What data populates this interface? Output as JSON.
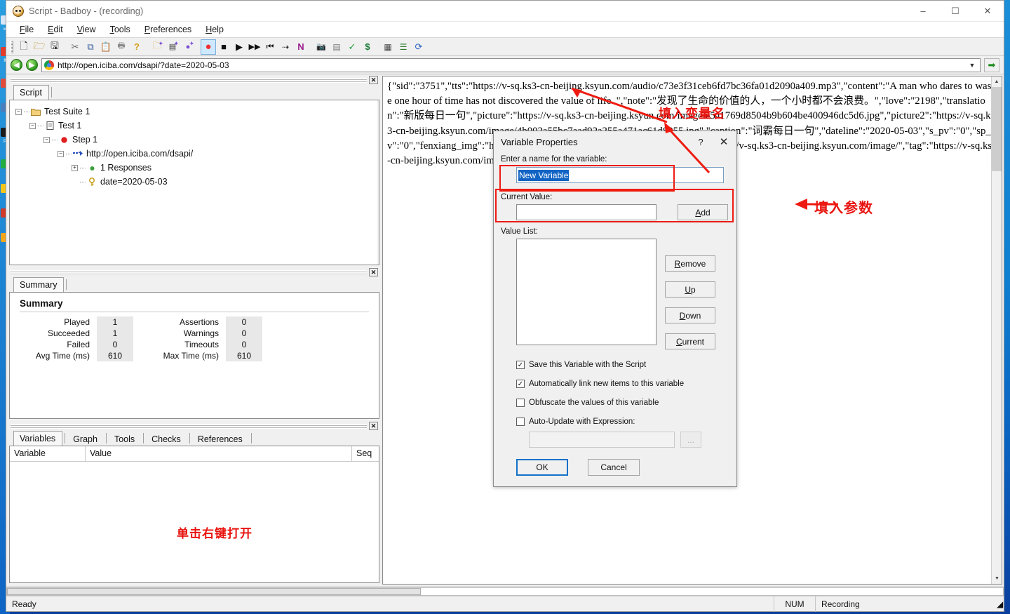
{
  "window": {
    "title": "Script - Badboy - (recording)",
    "app_icon": "badboy-face-icon",
    "minimize": "–",
    "maximize": "☐",
    "close": "✕"
  },
  "menubar": [
    {
      "label": "File",
      "accel": "F"
    },
    {
      "label": "Edit",
      "accel": "E"
    },
    {
      "label": "View",
      "accel": "V"
    },
    {
      "label": "Tools",
      "accel": "T"
    },
    {
      "label": "Preferences",
      "accel": "P"
    },
    {
      "label": "Help",
      "accel": "H"
    }
  ],
  "toolbar": {
    "buttons": [
      {
        "name": "new-icon",
        "glyph": "⬜"
      },
      {
        "name": "open-folder-icon",
        "glyph": "📂"
      },
      {
        "name": "save-icon",
        "glyph": "💾"
      },
      {
        "name": "cut-icon",
        "glyph": "✂"
      },
      {
        "name": "copy-icon",
        "glyph": "⧉"
      },
      {
        "name": "paste-icon",
        "glyph": "📋"
      },
      {
        "name": "print-icon",
        "glyph": "🖨"
      },
      {
        "name": "help-icon",
        "glyph": "?"
      },
      {
        "name": "new-suite-icon",
        "glyph": "📁"
      },
      {
        "name": "new-test-icon",
        "glyph": "☰"
      },
      {
        "name": "new-step-icon",
        "glyph": "●"
      },
      {
        "name": "record-icon",
        "glyph": "●"
      },
      {
        "name": "stop-icon",
        "glyph": "■"
      },
      {
        "name": "play-icon",
        "glyph": "▶"
      },
      {
        "name": "play-fast-icon",
        "glyph": "▶▶"
      },
      {
        "name": "rewind-icon",
        "glyph": "⏮"
      },
      {
        "name": "step-icon",
        "glyph": "⇥"
      },
      {
        "name": "navigator-icon",
        "glyph": "N"
      },
      {
        "name": "snapshot-icon",
        "glyph": "📷"
      },
      {
        "name": "report-icon",
        "glyph": "☰"
      },
      {
        "name": "check-icon",
        "glyph": "✓"
      },
      {
        "name": "dollar-icon",
        "glyph": "$"
      },
      {
        "name": "grid-icon",
        "glyph": "▦"
      },
      {
        "name": "list-icon",
        "glyph": "≡"
      },
      {
        "name": "refresh-icon",
        "glyph": "⟳"
      }
    ],
    "active_index": 11
  },
  "addressbar": {
    "back_icon": "back-arrow-icon",
    "forward_icon": "forward-arrow-icon",
    "site_icon": "chrome-icon",
    "url": "http://open.iciba.com/dsapi/?date=2020-05-03",
    "dropdown_icon": "chevron-down-icon",
    "go_icon": "go-arrow-icon"
  },
  "script_pane": {
    "close_label": "✕",
    "tabs": [
      {
        "label": "Script",
        "selected": true
      }
    ],
    "tree": [
      {
        "depth": 0,
        "expander": "-",
        "icon": "folder-icon",
        "label": "Test Suite 1"
      },
      {
        "depth": 1,
        "expander": "-",
        "icon": "test-icon",
        "label": "Test 1"
      },
      {
        "depth": 2,
        "expander": "-",
        "icon": "step-dot-icon",
        "label": "Step 1"
      },
      {
        "depth": 3,
        "expander": "-",
        "icon": "request-arrow-icon",
        "label": "http://open.iciba.com/dsapi/"
      },
      {
        "depth": 4,
        "expander": "+",
        "icon": "response-dot-icon",
        "label": "1 Responses"
      },
      {
        "depth": 4,
        "expander": "",
        "icon": "parameter-key-icon",
        "label": "date=2020-05-03"
      }
    ]
  },
  "summary_pane": {
    "close_label": "✕",
    "tabs": [
      {
        "label": "Summary",
        "selected": true
      }
    ],
    "heading": "Summary",
    "stats": [
      {
        "label_left": "Played",
        "value_left": "1",
        "label_right": "Assertions",
        "value_right": "0"
      },
      {
        "label_left": "Succeeded",
        "value_left": "1",
        "label_right": "Warnings",
        "value_right": "0"
      },
      {
        "label_left": "Failed",
        "value_left": "0",
        "label_right": "Timeouts",
        "value_right": "0"
      },
      {
        "label_left": "Avg Time (ms)",
        "value_left": "610",
        "label_right": "Max Time (ms)",
        "value_right": "610"
      }
    ]
  },
  "variables_pane": {
    "close_label": "✕",
    "tabs": [
      {
        "label": "Variables",
        "selected": true
      },
      {
        "label": "Graph",
        "selected": false
      },
      {
        "label": "Tools",
        "selected": false
      },
      {
        "label": "Checks",
        "selected": false
      },
      {
        "label": "References",
        "selected": false
      }
    ],
    "columns": [
      "Variable",
      "Value",
      "Seq"
    ],
    "rows": []
  },
  "response": {
    "text": "{\"sid\":\"3751\",\"tts\":\"https://v-sq.ks3-cn-beijing.ksyun.com/audio/c73e3f31ceb6fd7bc36fa01d2090a409.mp3\",\"content\":\"A man who dares to waste one hour of time has not discovered the value of life. \",\"note\":\"发现了生命的价值的人，一个小时都不会浪费。\",\"love\":\"2198\",\"translation\":\"新版每日一句\",\"picture\":\"https://v-sq.ks3-cn-beijing.ksyun.com/image/e5a1769d8504b9b604be400946dc5d6.jpg\",\"picture2\":\"https://v-sq.ks3-cn-beijing.ksyun.com/image/4b002a55bc7aad92a255a471ac61d8955.jpg\",\"caption\":\"词霸每日一句\",\"dateline\":\"2020-05-03\",\"s_pv\":\"0\",\"sp_pv\":\"0\",\"fenxiang_img\":\"https://v-sq.ks3-cn-beijing.ksyun.com/image/\",\"bb\":\"https://v-sq.ks3-cn-beijing.ksyun.com/image/\",\"tag\":\"https://v-sq.ks3-cn-beijing.ksyun.com/image/"
  },
  "dialog": {
    "title": "Variable Properties",
    "help_label": "?",
    "close_label": "✕",
    "name_label": "Enter a name for the variable:",
    "name_value": "New Variable",
    "current_value_label": "Current Value:",
    "current_value": "",
    "add_button": {
      "label": "Add",
      "accel": "A"
    },
    "value_list_label": "Value List:",
    "value_list_items": [],
    "side_buttons": [
      {
        "label": "Remove",
        "accel": "R"
      },
      {
        "label": "Up",
        "accel": "U"
      },
      {
        "label": "Down",
        "accel": "D"
      },
      {
        "label": "Current",
        "accel": "C"
      }
    ],
    "checkboxes": [
      {
        "label": "Save this Variable with the Script",
        "checked": true
      },
      {
        "label": "Automatically link new items to this variable",
        "checked": true
      },
      {
        "label": "Obfuscate the values of this variable",
        "checked": false
      },
      {
        "label": "Auto-Update with Expression:",
        "checked": false
      }
    ],
    "expression_value": "",
    "expression_browse_label": "...",
    "ok_button": "OK",
    "cancel_button": "Cancel"
  },
  "annotations": [
    {
      "name": "annotation-fill-variable-name",
      "text": "填入变量名"
    },
    {
      "name": "annotation-fill-parameter",
      "text": "填入参数"
    },
    {
      "name": "annotation-right-click-open",
      "text": "单击右键打开"
    }
  ],
  "statusbar": {
    "ready": "Ready",
    "num": "NUM",
    "recording": "Recording"
  },
  "colors": {
    "accent_red": "#ee1b11",
    "window_bg": "#f0f0f0",
    "desktop_blue": "#0f7fd0",
    "selection_blue": "#1264c4"
  }
}
